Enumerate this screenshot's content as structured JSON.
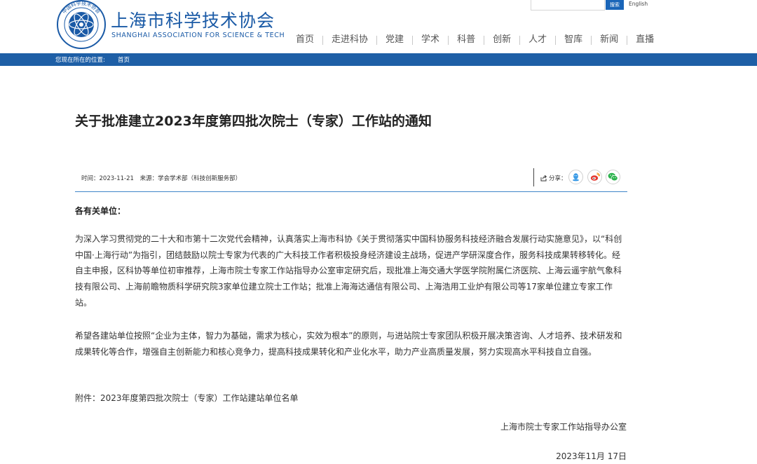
{
  "header": {
    "site_name_cn": "上海市科学技术协会",
    "site_name_en": "SHANGHAI ASSOCIATION FOR SCIENCE & TECH",
    "logo_text": "中国科学技术协会",
    "search": {
      "placeholder": "",
      "button_label": "搜索"
    },
    "lang_link": "English",
    "nav": [
      "首页",
      "走进科协",
      "党建",
      "学术",
      "科普",
      "创新",
      "人才",
      "智库",
      "新闻",
      "直播"
    ]
  },
  "breadcrumb": {
    "label": "您现在所在的位置:",
    "home": "首页"
  },
  "article": {
    "title": "关于批准建立2023年度第四批次院士（专家）工作站的通知",
    "meta_time": "时间：2023-11-21",
    "meta_source": "来源：学会学术部（科技创新服务部）",
    "share_label": "分享：",
    "greeting": "各有关单位：",
    "paragraphs": [
      "为深入学习贯彻党的二十大和市第十二次党代会精神，认真落实上海市科协《关于贯彻落实中国科协服务科技经济融合发展行动实施意见》，以“科创中国·上海行动”为指引，团结鼓励以院士专家为代表的广大科技工作者积极投身经济建设主战场，促进产学研深度合作，服务科技成果转移转化。经自主申报，区科协等单位初审推荐，上海市院士专家工作站指导办公室审定研究后，现批准上海交通大学医学院附属仁济医院、上海云遥宇航气象科技有限公司、上海前瞻物质科学研究院3家单位建立院士工作站；批准上海海达通信有限公司、上海浩用工业炉有限公司等17家单位建立专家工作站。",
      "希望各建站单位按照“企业为主体，智力为基础，需求为核心，实效为根本”的原则，与进站院士专家团队积极开展决策咨询、人才培养、技术研发和成果转化等合作，增强自主创新能力和核心竞争力，提高科技成果转化和产业化水平，助力产业高质量发展，努力实现高水平科技自立自强。"
    ],
    "attachment": "附件：2023年度第四批次院士（专家）工作站建站单位名单",
    "signature": "上海市院士专家工作站指导办公室",
    "date": "2023年11月 17日"
  },
  "colors": {
    "brand_blue": "#1a5aa6",
    "bar_blue": "#1e5fa6",
    "divider_blue": "#3f86c9"
  }
}
